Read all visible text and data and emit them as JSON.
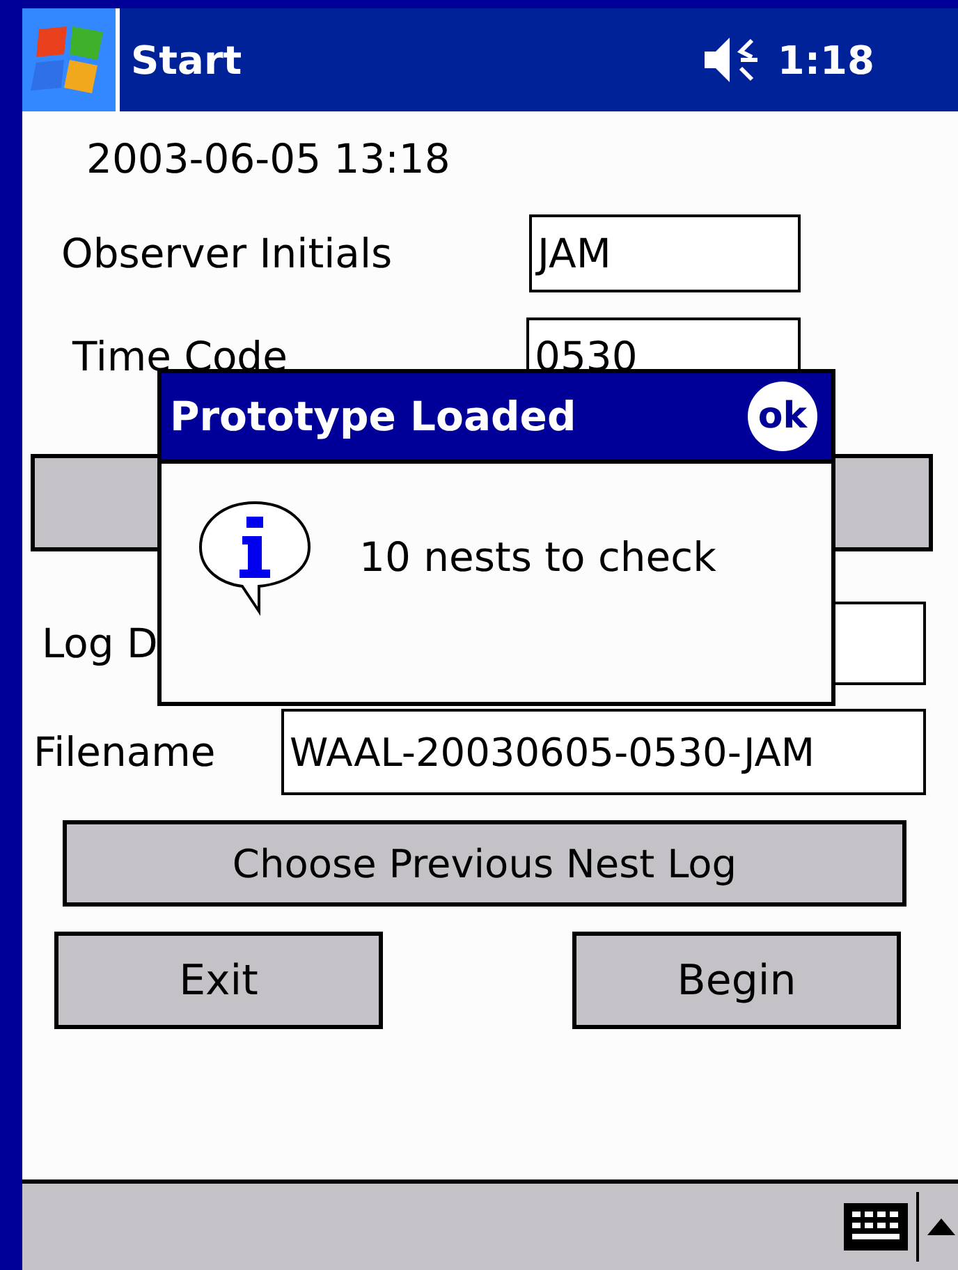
{
  "top_bar": {
    "title": "Start",
    "clock": "1:18"
  },
  "form": {
    "timestamp": "2003-06-05 13:18",
    "observer_label": "Observer Initials",
    "observer_value": "JAM",
    "time_code_label": "Time Code",
    "time_code_value": "0530",
    "log_label": "Log D",
    "filename_label": "Filename",
    "filename_value": "WAAL-20030605-0530-JAM",
    "choose_button": "Choose Previous Nest Log",
    "buttons": [
      "Exit",
      "Begin"
    ]
  },
  "dialog": {
    "title": "Prototype Loaded",
    "ok": "ok",
    "message": "10 nests to check"
  }
}
